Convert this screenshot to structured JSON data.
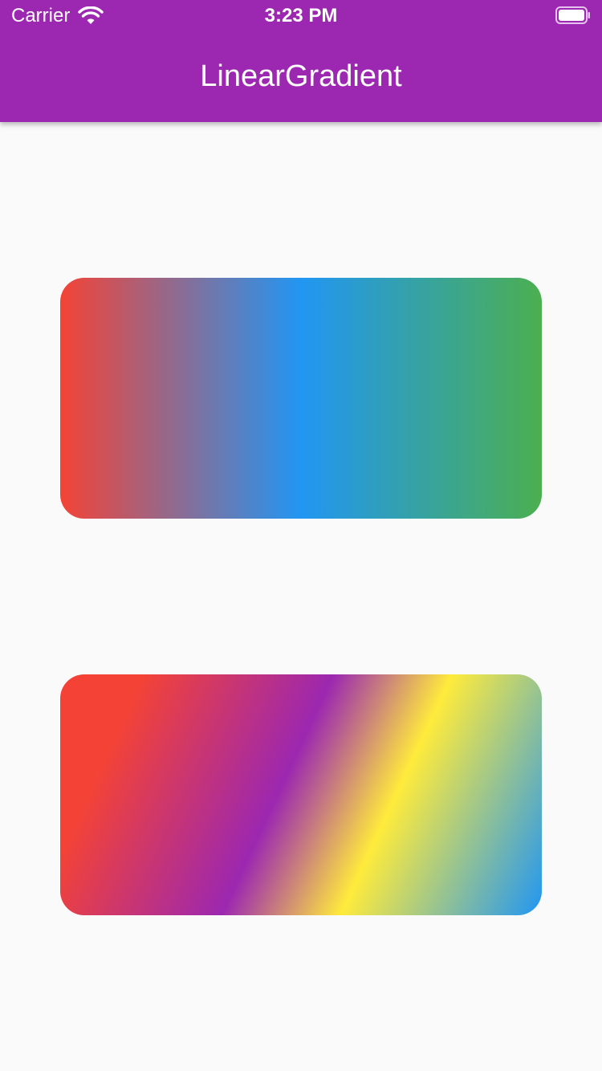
{
  "status_bar": {
    "carrier": "Carrier",
    "time": "3:23 PM",
    "wifi_icon": "wifi-icon",
    "battery_icon": "battery-icon"
  },
  "app_bar": {
    "title": "LinearGradient",
    "background_color": "#9c27b0"
  },
  "page": {
    "background_color": "#fafafa"
  },
  "gradients": [
    {
      "name": "horizontal-gradient",
      "direction": "left-to-right",
      "colors": [
        "#f44336",
        "#2196f3",
        "#4caf50"
      ]
    },
    {
      "name": "diagonal-gradient",
      "direction": "top-left-to-bottom-right",
      "colors": [
        "#f44336",
        "#9c27b0",
        "#ffeb3b",
        "#2196f3"
      ]
    }
  ]
}
